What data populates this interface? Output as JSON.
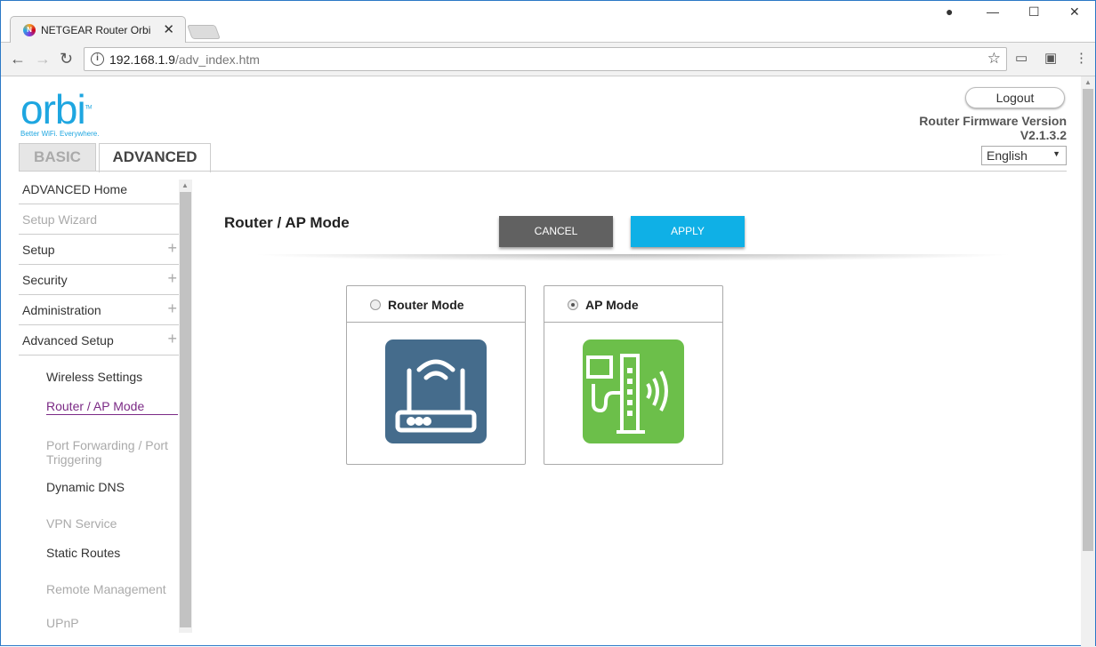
{
  "browser": {
    "tab_title": "NETGEAR Router Orbi",
    "favicon": "N",
    "url_host": "192.168.1.9",
    "url_path": "/adv_index.htm"
  },
  "header": {
    "logo": "orbi",
    "logo_tm": "TM",
    "tagline": "Better WiFi. Everywhere.",
    "logout": "Logout",
    "fw_label": "Router Firmware Version",
    "fw_version": "V2.1.3.2",
    "language": "English"
  },
  "tabs": {
    "basic": "BASIC",
    "advanced": "ADVANCED"
  },
  "sidebar": {
    "items": [
      {
        "label": "ADVANCED Home"
      },
      {
        "label": "Setup Wizard"
      },
      {
        "label": "Setup"
      },
      {
        "label": "Security"
      },
      {
        "label": "Administration"
      },
      {
        "label": "Advanced Setup"
      }
    ],
    "sub": [
      "Wireless Settings",
      "Router / AP Mode",
      "Port Forwarding / Port Triggering",
      "Dynamic DNS",
      "VPN Service",
      "Static Routes",
      "Remote Management",
      "UPnP"
    ]
  },
  "main": {
    "title": "Router / AP Mode",
    "cancel": "CANCEL",
    "apply": "APPLY",
    "modes": [
      {
        "label": "Router Mode",
        "selected": false,
        "color": "#456c8c"
      },
      {
        "label": "AP Mode",
        "selected": true,
        "color": "#6cbf4a"
      }
    ]
  }
}
